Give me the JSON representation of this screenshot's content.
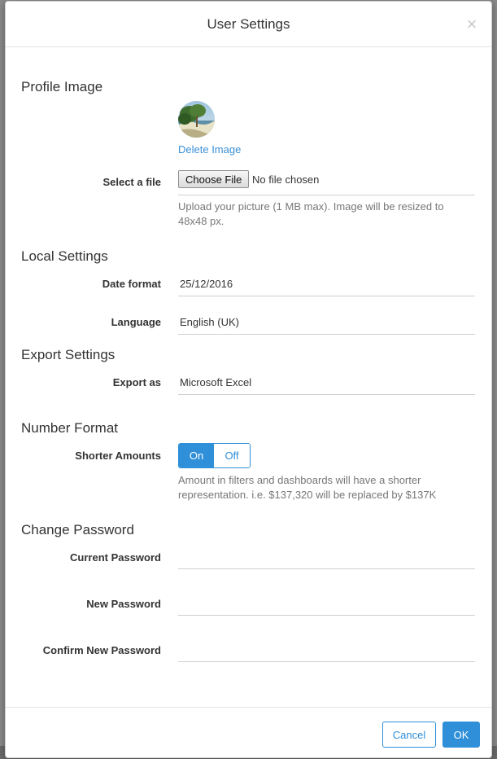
{
  "dialog": {
    "title": "User Settings",
    "close_symbol": "×"
  },
  "profile": {
    "section_title": "Profile Image",
    "delete_link": "Delete Image",
    "select_label": "Select a file",
    "choose_button": "Choose File",
    "no_file_text": "No file chosen",
    "help": "Upload your picture (1 MB max). Image will be resized to 48x48 px."
  },
  "local": {
    "section_title": "Local Settings",
    "date_label": "Date format",
    "date_value": "25/12/2016",
    "language_label": "Language",
    "language_value": "English (UK)"
  },
  "export": {
    "section_title": "Export Settings",
    "export_label": "Export as",
    "export_value": "Microsoft Excel"
  },
  "number": {
    "section_title": "Number Format",
    "shorter_label": "Shorter Amounts",
    "on_label": "On",
    "off_label": "Off",
    "selected": "On",
    "help": "Amount in filters and dashboards will have a shorter representation. i.e. $137,320 will be replaced by $137K"
  },
  "password": {
    "section_title": "Change Password",
    "current_label": "Current Password",
    "new_label": "New Password",
    "confirm_label": "Confirm New Password"
  },
  "footer": {
    "cancel_label": "Cancel",
    "ok_label": "OK"
  },
  "colors": {
    "accent": "#2f8fd8",
    "link": "#3a8fd6"
  },
  "icons": {
    "close": "close-icon",
    "avatar": "profile-avatar-image"
  }
}
